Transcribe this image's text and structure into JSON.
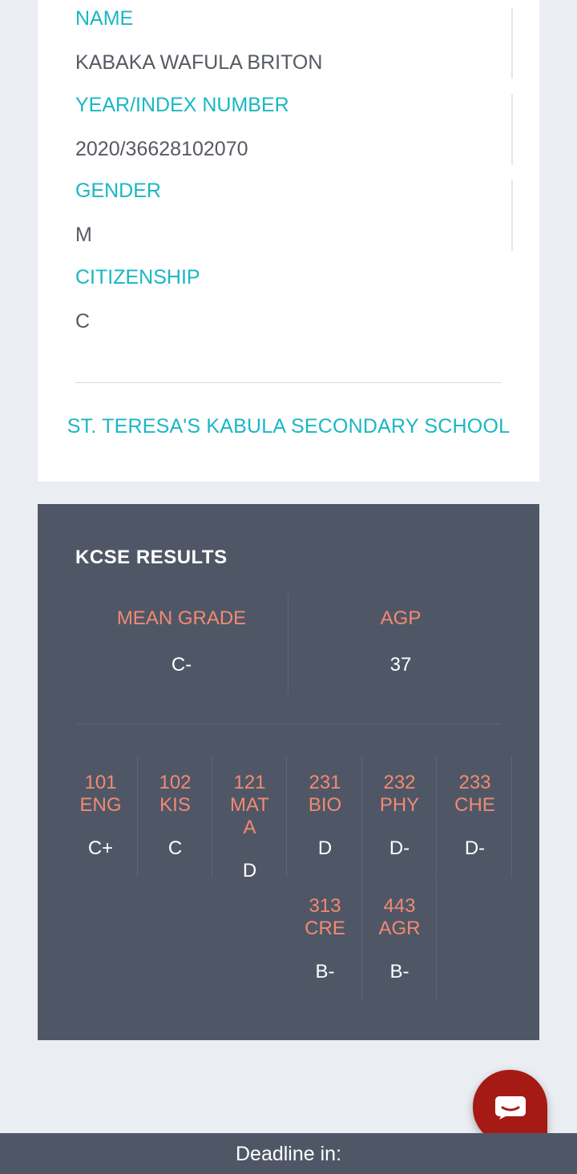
{
  "student": {
    "name_label": "NAME",
    "name": "KABAKA WAFULA BRITON",
    "index_label": "YEAR/INDEX NUMBER",
    "index": "2020/36628102070",
    "gender_label": "GENDER",
    "gender": "M",
    "citizenship_label": "CITIZENSHIP",
    "citizenship": "C",
    "school": "ST. TERESA'S KABULA SECONDARY SCHOOL"
  },
  "results": {
    "title": "KCSE RESULTS",
    "mean_grade_label": "MEAN GRADE",
    "mean_grade": "C-",
    "agp_label": "AGP",
    "agp": "37",
    "subjects": [
      {
        "code": "101",
        "name": "ENG",
        "grade": "C+"
      },
      {
        "code": "102",
        "name": "KIS",
        "grade": "C"
      },
      {
        "code": "121",
        "name": "MAT",
        "name_wrap": "A",
        "grade": "D"
      },
      {
        "code": "231",
        "name": "BIO",
        "grade": "D"
      },
      {
        "code": "232",
        "name": "PHY",
        "grade": "D-"
      },
      {
        "code": "233",
        "name": "CHE",
        "grade": "D-"
      },
      {
        "code": "313",
        "name": "CRE",
        "grade": "B-"
      },
      {
        "code": "443",
        "name": "AGR",
        "grade": "B-"
      }
    ]
  },
  "footer": {
    "deadline_label": "Deadline in:"
  },
  "colors": {
    "accent": "#19b7c4",
    "label_orange": "#f28a70",
    "panel": "#4f5767",
    "chat": "#a51a14"
  },
  "icons": {
    "chat": "chat-bubble-icon"
  }
}
